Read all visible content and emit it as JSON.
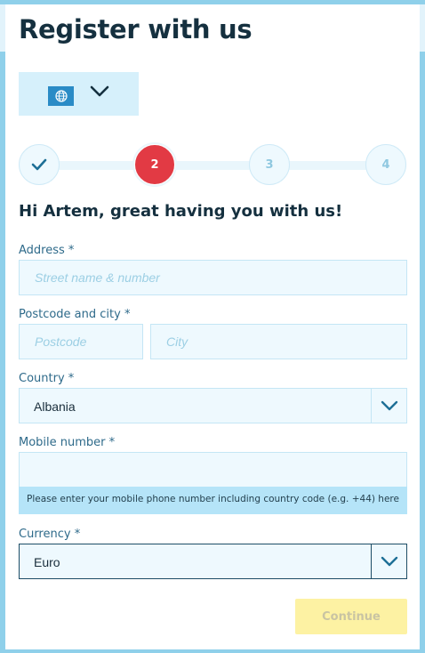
{
  "header": {
    "title": "Register with us"
  },
  "language_selector": {
    "icon": "globe-icon",
    "chevron": "chevron-down-icon"
  },
  "stepper": {
    "steps": [
      {
        "label": "",
        "state": "done"
      },
      {
        "label": "2",
        "state": "active"
      },
      {
        "label": "3",
        "state": "pending"
      },
      {
        "label": "4",
        "state": "pending"
      }
    ],
    "active_color": "#e23a44"
  },
  "greeting": "Hi Artem, great having you with us!",
  "form": {
    "address": {
      "label": "Address *",
      "placeholder": "Street name & number",
      "value": ""
    },
    "postcode_city": {
      "label": "Postcode and city *",
      "postcode_placeholder": "Postcode",
      "city_placeholder": "City"
    },
    "country": {
      "label": "Country *",
      "value": "Albania"
    },
    "mobile": {
      "label": "Mobile number *",
      "value": "",
      "hint": "Please enter your mobile phone number including country code (e.g. +44) here"
    },
    "currency": {
      "label": "Currency *",
      "value": "Euro"
    }
  },
  "actions": {
    "continue_label": "Continue"
  },
  "colors": {
    "accent": "#8fd0ea",
    "button": "#fdf2a3",
    "field_bg": "#eef9fe"
  }
}
